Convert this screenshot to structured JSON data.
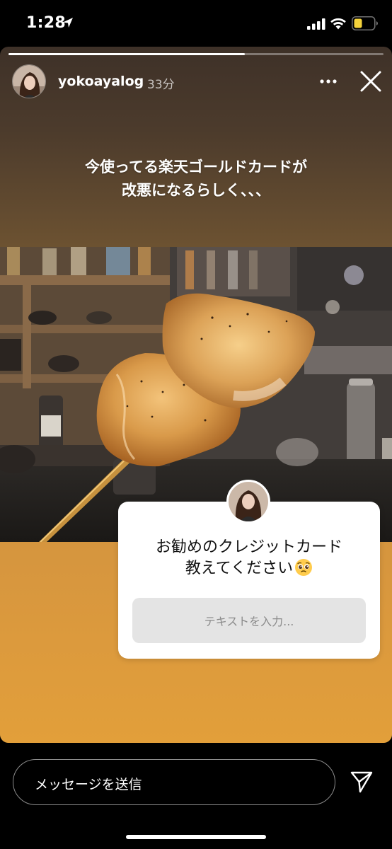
{
  "status_bar": {
    "time": "1:28",
    "icons": [
      "location-arrow-icon",
      "cellular-signal-icon",
      "wifi-icon",
      "battery-icon"
    ],
    "battery_color": "#f5d33b"
  },
  "story": {
    "progress": 0.63,
    "username": "yokoayalog",
    "timestamp": "33分",
    "caption_line1": "今使ってる楽天ゴールドカードが",
    "caption_line2": "改悪になるらしく、、、",
    "photo": "photo of grilled chicken skewer (yakitori) in front of bar shelves"
  },
  "question_sticker": {
    "line1": "お勧めのクレジットカード",
    "line2": "教えてください",
    "emoji": "pleading-face-emoji",
    "input_placeholder": "テキストを入力..."
  },
  "bottom_bar": {
    "message_placeholder": "メッセージを送信",
    "send_icon": "paper-plane-icon"
  },
  "colors": {
    "story_top": "#3e3128",
    "story_bottom": "#e29f3a",
    "sticker_bg": "#ffffff",
    "input_bg": "#e4e4e4"
  }
}
